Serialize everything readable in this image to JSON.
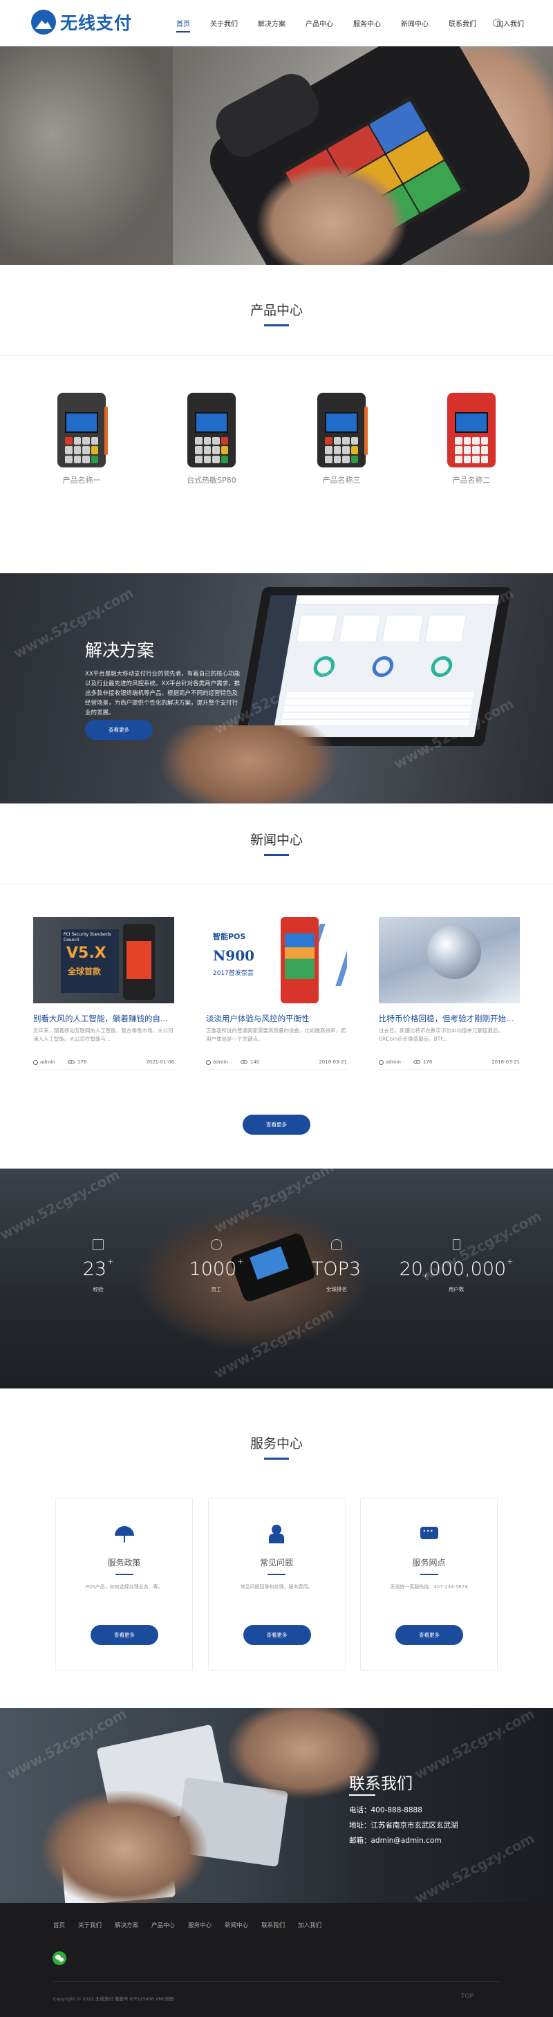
{
  "header": {
    "logo_text": "无线支付",
    "nav": [
      "首页",
      "关于我们",
      "解决方案",
      "产品中心",
      "服务中心",
      "新闻中心",
      "联系我们",
      "加入我们"
    ]
  },
  "products": {
    "title": "产品中心",
    "items": [
      {
        "label": "产品名称一"
      },
      {
        "label": "台式热敏SP80"
      },
      {
        "label": "产品名称三"
      },
      {
        "label": "产品名称二"
      }
    ]
  },
  "solution": {
    "title": "解决方案",
    "desc": "XX平台是融大移动支付行业的领先者，有着自己的核心功能以及行业最先进的风控系统。XX平台针对各类商户需求，推出多款非接收银终端机等产品，根据商户不同的经营特色及经营场景，为商户提供个性化的解决方案，提升整个支付行业的发展。",
    "button": "查看更多"
  },
  "news": {
    "title": "新闻中心",
    "items": [
      {
        "title": "别看大风的人工智能，躺着赚钱的自...",
        "desc": "近年来，随着移动互联网的人工智能，整合零售市场，大公司涌入人工智能。大公司在智能与...",
        "author": "admin",
        "views": "176",
        "date": "2021-01-06",
        "img_text": [
          "PCI Security Standards Council",
          "V5.X",
          "全球首款"
        ]
      },
      {
        "title": "淡淡用户体验与风控的平衡性",
        "desc": "正像我所说的普通商家需要高质量的设备，比如提高效率，而用户体验是一个关键点。",
        "author": "admin",
        "views": "140",
        "date": "2018-03-21",
        "img_text": [
          "智能POS",
          "N900",
          "2017首发奈芸"
        ]
      },
      {
        "title": "比特币价格回稳，但考验才刚刚开始...",
        "desc": "过去日，新疆比特币在数字币价中均值单元额值最后，OKCoin币价换值最后，BTF...",
        "author": "admin",
        "views": "176",
        "date": "2018-03-21",
        "img_text": []
      }
    ],
    "button": "查看更多"
  },
  "stats": [
    {
      "num": "23",
      "sup": "+",
      "label": "经验",
      "icon": "book-icon"
    },
    {
      "num": "1000",
      "sup": "+",
      "label": "员工",
      "icon": "users-icon"
    },
    {
      "num": "TOP3",
      "sup": "",
      "label": "全球排名",
      "icon": "medal-icon"
    },
    {
      "num": "20,000,000",
      "sup": "+",
      "label": "用户数",
      "icon": "phone-icon"
    }
  ],
  "services": {
    "title": "服务中心",
    "items": [
      {
        "title": "服务政策",
        "desc": "POS产品，如何选择办理业务...等。",
        "button": "查看更多",
        "icon": "umbrella-icon"
      },
      {
        "title": "常见问题",
        "desc": "常见问题回答和处理，服务费用。",
        "button": "查看更多",
        "icon": "user-icon"
      },
      {
        "title": "服务网点",
        "desc": "无锡统一客服热线：407-234-5678",
        "button": "查看更多",
        "icon": "chat-icon"
      }
    ]
  },
  "contact": {
    "title": "联系我们",
    "phone_label": "电话：",
    "phone": "400-888-8888",
    "address_label": "地址：",
    "address": "江苏省南京市玄武区玄武湖",
    "email_label": "邮箱：",
    "email": "admin@admin.com"
  },
  "footer": {
    "nav": [
      "首页",
      "关于我们",
      "解决方案",
      "产品中心",
      "服务中心",
      "新闻中心",
      "联系我们",
      "加入我们"
    ],
    "copyright": "Copyright © 2022 无线支付 备案号 ICP123456  XML地图",
    "totop": "TOP"
  },
  "watermark": "www.52cgzy.com"
}
